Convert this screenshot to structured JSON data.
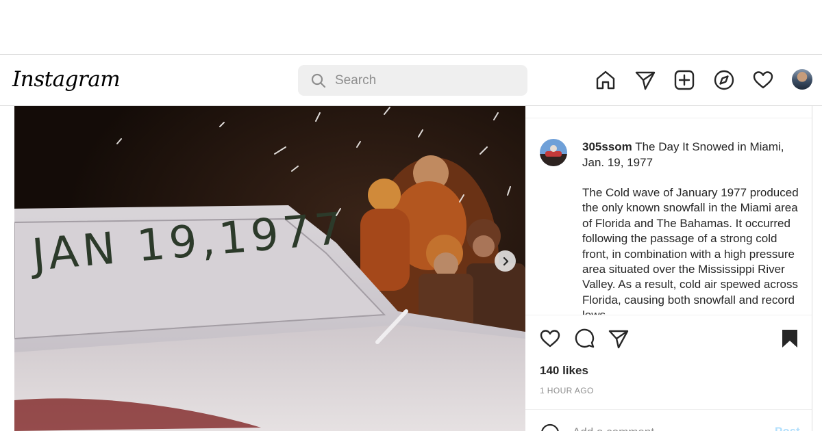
{
  "app": {
    "logo_text": "Instagram"
  },
  "search": {
    "placeholder": "Search"
  },
  "nav": {
    "icons": [
      "home-icon",
      "direct-message-icon",
      "new-post-icon",
      "explore-icon",
      "activity-heart-icon",
      "profile-avatar"
    ]
  },
  "post": {
    "username": "305ssom",
    "title": "The Day It Snowed in Miami, Jan. 19, 1977",
    "body": "The Cold wave of January 1977 produced the only known snowfall in the Miami area of Florida and The Bahamas. It occurred following the passage of a strong cold front, in combination with a high pressure area situated over the Mississippi River Valley. As a result, cold air spewed across Florida, causing both snowfall and record lows.",
    "image_text": "JAN 19,1977",
    "likes": "140 likes",
    "time": "1 HOUR AGO",
    "comment_placeholder": "Add a comment…",
    "post_button": "Post"
  },
  "colors": {
    "text": "#262626",
    "secondary": "#8e8e8e",
    "border": "#dbdbdb",
    "search_bg": "#efefef",
    "post_button_disabled": "#b2dffc"
  }
}
